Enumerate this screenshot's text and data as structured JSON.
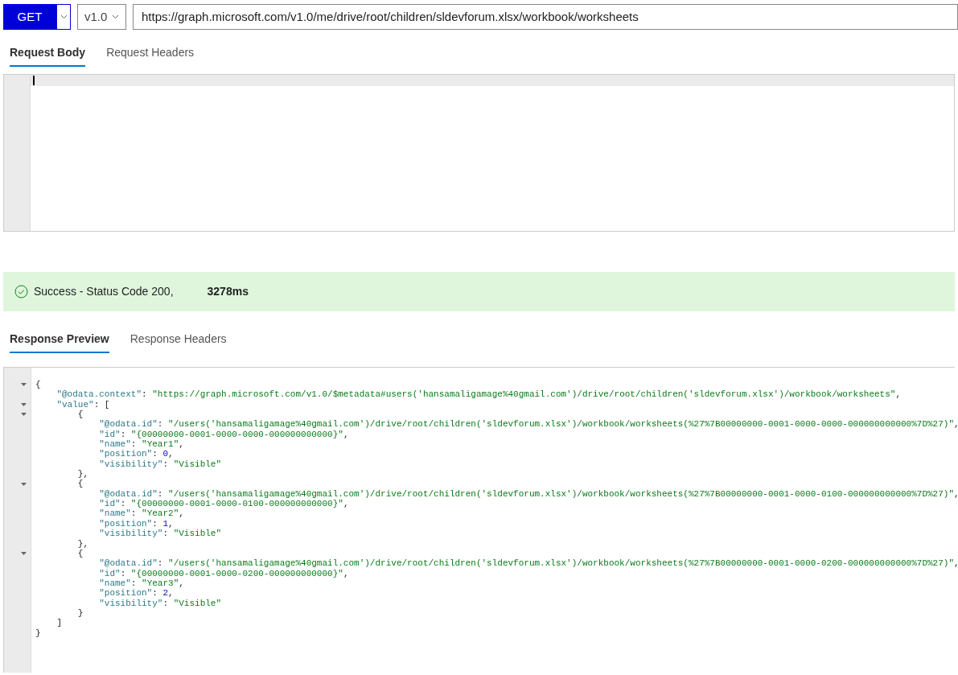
{
  "request": {
    "method": "GET",
    "version": "v1.0",
    "url": "https://graph.microsoft.com/v1.0/me/drive/root/children/sldevforum.xlsx/workbook/worksheets"
  },
  "request_tabs": [
    {
      "label": "Request Body",
      "selected": true
    },
    {
      "label": "Request Headers",
      "selected": false
    }
  ],
  "status": {
    "message": "Success - Status Code 200,",
    "duration": "3278ms"
  },
  "response_tabs": [
    {
      "label": "Response Preview",
      "selected": true
    },
    {
      "label": "Response Headers",
      "selected": false
    }
  ],
  "response_lines": [
    {
      "foldable": true,
      "tokens": [
        {
          "kind": "punct",
          "text": "{"
        }
      ]
    },
    {
      "foldable": false,
      "tokens": [
        {
          "kind": "key",
          "text": "    \"@odata.context\""
        },
        {
          "kind": "punct",
          "text": ": "
        },
        {
          "kind": "string",
          "text": "\"https://graph.microsoft.com/v1.0/$metadata#users('hansamaligamage%40gmail.com')/drive/root/children('sldevforum.xlsx')/workbook/worksheets\""
        },
        {
          "kind": "punct",
          "text": ","
        }
      ]
    },
    {
      "foldable": true,
      "tokens": [
        {
          "kind": "key",
          "text": "    \"value\""
        },
        {
          "kind": "punct",
          "text": ": ["
        }
      ]
    },
    {
      "foldable": true,
      "tokens": [
        {
          "kind": "punct",
          "text": "        {"
        }
      ]
    },
    {
      "foldable": false,
      "tokens": [
        {
          "kind": "key",
          "text": "            \"@odata.id\""
        },
        {
          "kind": "punct",
          "text": ": "
        },
        {
          "kind": "string",
          "text": "\"/users('hansamaligamage%40gmail.com')/drive/root/children('sldevforum.xlsx')/workbook/worksheets(%27%7B00000000-0001-0000-0000-000000000000%7D%27)\""
        },
        {
          "kind": "punct",
          "text": ","
        }
      ]
    },
    {
      "foldable": false,
      "tokens": [
        {
          "kind": "key",
          "text": "            \"id\""
        },
        {
          "kind": "punct",
          "text": ": "
        },
        {
          "kind": "string",
          "text": "\"{00000000-0001-0000-0000-000000000000}\""
        },
        {
          "kind": "punct",
          "text": ","
        }
      ]
    },
    {
      "foldable": false,
      "tokens": [
        {
          "kind": "key",
          "text": "            \"name\""
        },
        {
          "kind": "punct",
          "text": ": "
        },
        {
          "kind": "string",
          "text": "\"Year1\""
        },
        {
          "kind": "punct",
          "text": ","
        }
      ]
    },
    {
      "foldable": false,
      "tokens": [
        {
          "kind": "key",
          "text": "            \"position\""
        },
        {
          "kind": "punct",
          "text": ": "
        },
        {
          "kind": "number",
          "text": "0"
        },
        {
          "kind": "punct",
          "text": ","
        }
      ]
    },
    {
      "foldable": false,
      "tokens": [
        {
          "kind": "key",
          "text": "            \"visibility\""
        },
        {
          "kind": "punct",
          "text": ": "
        },
        {
          "kind": "string",
          "text": "\"Visible\""
        }
      ]
    },
    {
      "foldable": false,
      "tokens": [
        {
          "kind": "punct",
          "text": "        },"
        }
      ]
    },
    {
      "foldable": true,
      "tokens": [
        {
          "kind": "punct",
          "text": "        {"
        }
      ]
    },
    {
      "foldable": false,
      "tokens": [
        {
          "kind": "key",
          "text": "            \"@odata.id\""
        },
        {
          "kind": "punct",
          "text": ": "
        },
        {
          "kind": "string",
          "text": "\"/users('hansamaligamage%40gmail.com')/drive/root/children('sldevforum.xlsx')/workbook/worksheets(%27%7B00000000-0001-0000-0100-000000000000%7D%27)\""
        },
        {
          "kind": "punct",
          "text": ","
        }
      ]
    },
    {
      "foldable": false,
      "tokens": [
        {
          "kind": "key",
          "text": "            \"id\""
        },
        {
          "kind": "punct",
          "text": ": "
        },
        {
          "kind": "string",
          "text": "\"{00000000-0001-0000-0100-000000000000}\""
        },
        {
          "kind": "punct",
          "text": ","
        }
      ]
    },
    {
      "foldable": false,
      "tokens": [
        {
          "kind": "key",
          "text": "            \"name\""
        },
        {
          "kind": "punct",
          "text": ": "
        },
        {
          "kind": "string",
          "text": "\"Year2\""
        },
        {
          "kind": "punct",
          "text": ","
        }
      ]
    },
    {
      "foldable": false,
      "tokens": [
        {
          "kind": "key",
          "text": "            \"position\""
        },
        {
          "kind": "punct",
          "text": ": "
        },
        {
          "kind": "number",
          "text": "1"
        },
        {
          "kind": "punct",
          "text": ","
        }
      ]
    },
    {
      "foldable": false,
      "tokens": [
        {
          "kind": "key",
          "text": "            \"visibility\""
        },
        {
          "kind": "punct",
          "text": ": "
        },
        {
          "kind": "string",
          "text": "\"Visible\""
        }
      ]
    },
    {
      "foldable": false,
      "tokens": [
        {
          "kind": "punct",
          "text": "        },"
        }
      ]
    },
    {
      "foldable": true,
      "tokens": [
        {
          "kind": "punct",
          "text": "        {"
        }
      ]
    },
    {
      "foldable": false,
      "tokens": [
        {
          "kind": "key",
          "text": "            \"@odata.id\""
        },
        {
          "kind": "punct",
          "text": ": "
        },
        {
          "kind": "string",
          "text": "\"/users('hansamaligamage%40gmail.com')/drive/root/children('sldevforum.xlsx')/workbook/worksheets(%27%7B00000000-0001-0000-0200-000000000000%7D%27)\""
        },
        {
          "kind": "punct",
          "text": ","
        }
      ]
    },
    {
      "foldable": false,
      "tokens": [
        {
          "kind": "key",
          "text": "            \"id\""
        },
        {
          "kind": "punct",
          "text": ": "
        },
        {
          "kind": "string",
          "text": "\"{00000000-0001-0000-0200-000000000000}\""
        },
        {
          "kind": "punct",
          "text": ","
        }
      ]
    },
    {
      "foldable": false,
      "tokens": [
        {
          "kind": "key",
          "text": "            \"name\""
        },
        {
          "kind": "punct",
          "text": ": "
        },
        {
          "kind": "string",
          "text": "\"Year3\""
        },
        {
          "kind": "punct",
          "text": ","
        }
      ]
    },
    {
      "foldable": false,
      "tokens": [
        {
          "kind": "key",
          "text": "            \"position\""
        },
        {
          "kind": "punct",
          "text": ": "
        },
        {
          "kind": "number",
          "text": "2"
        },
        {
          "kind": "punct",
          "text": ","
        }
      ]
    },
    {
      "foldable": false,
      "tokens": [
        {
          "kind": "key",
          "text": "            \"visibility\""
        },
        {
          "kind": "punct",
          "text": ": "
        },
        {
          "kind": "string",
          "text": "\"Visible\""
        }
      ]
    },
    {
      "foldable": false,
      "tokens": [
        {
          "kind": "punct",
          "text": "        }"
        }
      ]
    },
    {
      "foldable": false,
      "tokens": [
        {
          "kind": "punct",
          "text": "    ]"
        }
      ]
    },
    {
      "foldable": false,
      "tokens": [
        {
          "kind": "punct",
          "text": "}"
        }
      ]
    }
  ]
}
